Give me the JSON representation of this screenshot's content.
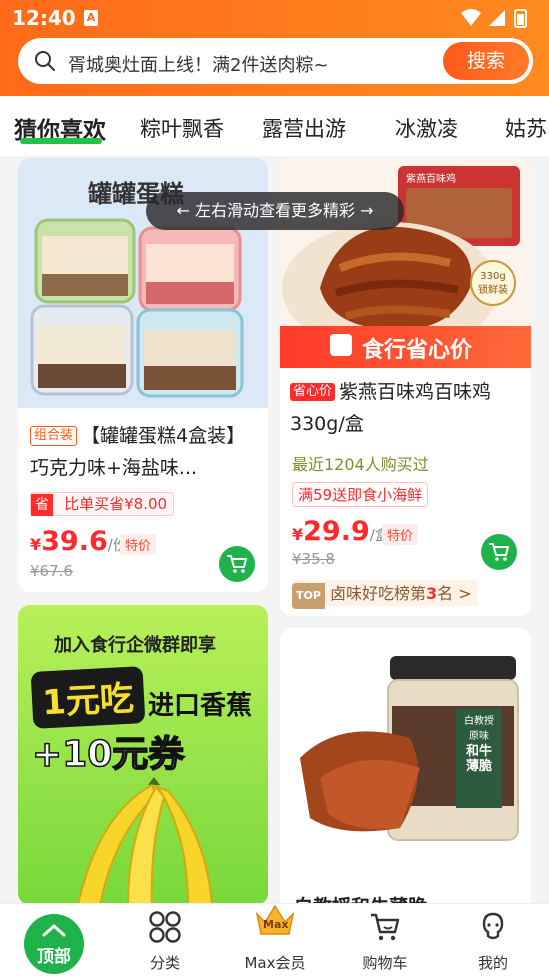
{
  "status": {
    "time": "12:40",
    "app_badge": "A"
  },
  "search": {
    "placeholder_text": "胥城奥灶面上线！满2件送肉粽~",
    "button": "搜索"
  },
  "tabs": [
    {
      "label": "猜你喜欢",
      "active": true
    },
    {
      "label": "粽叶飘香"
    },
    {
      "label": "露营出游"
    },
    {
      "label": "冰激凌"
    },
    {
      "label": "姑苏"
    }
  ],
  "hint": "← 左右滑动查看更多精彩 →",
  "products": {
    "cake": {
      "banner": "罐罐蛋糕",
      "tag": "组合装",
      "title": "【罐罐蛋糕4盒装】巧克力味+海盐味...",
      "promo_tag": "省",
      "promo_text": "比单买省¥8.00",
      "price_yen": "¥",
      "price": "39.6",
      "unit": "/份",
      "special": "特价",
      "old_price": "¥67.6"
    },
    "chicken": {
      "brand_strip": "紫燕百味鸡",
      "weight_badge": "330g\n锁鲜装",
      "banner": "食行省心价",
      "tag": "省心价",
      "title": "紫燕百味鸡百味鸡330g/盒",
      "recent": "最近1204人购买过",
      "promo": "满59送即食小海鲜",
      "price_yen": "¥",
      "price": "29.9",
      "unit": "/盒",
      "special": "特价",
      "old_price": "¥35.8",
      "rank_badge": "TOP",
      "rank_text": "卤味好吃榜第",
      "rank_num": "3",
      "rank_suffix": "名 >"
    },
    "banana": {
      "line1": "加入食行企微群即享",
      "big1": "1元吃",
      "line2": "进口香蕉",
      "big2": "+10元券"
    },
    "beef": {
      "jar_brand": "白教授",
      "jar_side1": "原味",
      "jar_main": "和牛薄脆",
      "title_partial": "白教授和牛薄脆"
    }
  },
  "bottom_nav": {
    "top_label": "顶部",
    "items": [
      {
        "label": "分类",
        "icon": "grid-icon"
      },
      {
        "label": "Max会员",
        "icon": "crown-icon",
        "badge": "Max"
      },
      {
        "label": "购物车",
        "icon": "cart-icon"
      },
      {
        "label": "我的",
        "icon": "user-icon"
      }
    ]
  },
  "colors": {
    "brand_orange": "#ff7a1e",
    "price_red": "#ff2a2a",
    "green": "#1fb24a"
  }
}
